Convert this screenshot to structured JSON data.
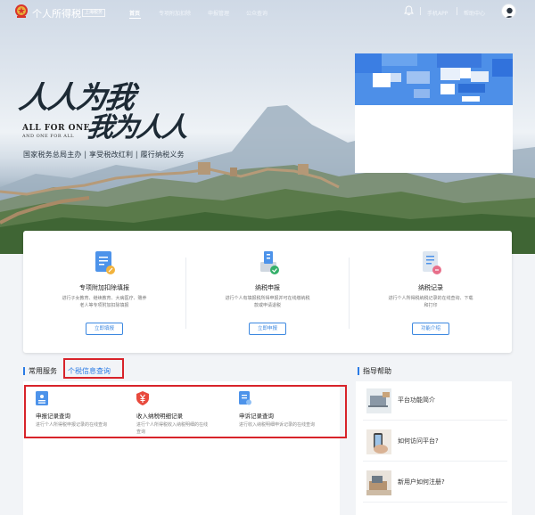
{
  "header": {
    "brand": "个人所得税",
    "region": "上海税务",
    "nav": [
      {
        "label": "首页",
        "active": true
      },
      {
        "label": "专项附加扣除",
        "active": false
      },
      {
        "label": "申报管理",
        "active": false
      },
      {
        "label": "公众查询",
        "active": false
      }
    ],
    "mobile_app": "手机APP",
    "help_center": "帮助中心"
  },
  "hero": {
    "slogan_line1": "人人为我",
    "slogan_line2": "我为人人",
    "english_line1": "ALL FOR ONE",
    "english_line2": "AND ONE FOR ALL",
    "motto": "国家税务总局主办 | 享受税改红利 | 履行纳税义务"
  },
  "services": [
    {
      "icon": "document-pen-icon",
      "title": "专项附加扣除填报",
      "desc_lines": [
        "进行子女教育、继续教育、大病医疗、赡养",
        "老人等专项附加扣除填报"
      ],
      "button": "立即填报"
    },
    {
      "icon": "tax-declare-icon",
      "title": "纳税申报",
      "desc_lines": [
        "进行个人有填报税所得申报并可在线缴纳税",
        "款或申请退税"
      ],
      "button": "立即申报"
    },
    {
      "icon": "tax-record-icon",
      "title": "纳税记录",
      "desc_lines": [
        "进行个人所得税纳税记录的在线查询、下载",
        "和打印"
      ],
      "button": "功能介绍"
    }
  ],
  "common": {
    "section_title": "常用服务",
    "active_tab": "个税信息查询",
    "items": [
      {
        "icon": "declaration-record-icon",
        "title": "申报记录查询",
        "desc_lines": [
          "进行个人所得税申报记录的在线查询"
        ]
      },
      {
        "icon": "income-detail-icon",
        "title": "收入纳税明细记录",
        "desc_lines": [
          "进行个人所得税收入纳税明细的在线",
          "查询"
        ]
      },
      {
        "icon": "appeal-record-icon",
        "title": "申诉记录查询",
        "desc_lines": [
          "进行收入纳税明细申诉记录的在线查询"
        ]
      }
    ]
  },
  "help": {
    "title": "指导帮助",
    "items": [
      {
        "label": "平台功能简介"
      },
      {
        "label": "如何访问平台?"
      },
      {
        "label": "新用户如何注册?"
      }
    ]
  },
  "colors": {
    "accent": "#2b7be5",
    "highlight_box": "#d8232a",
    "icon_blue": "#4d93ea",
    "icon_red": "#e84a3d"
  }
}
